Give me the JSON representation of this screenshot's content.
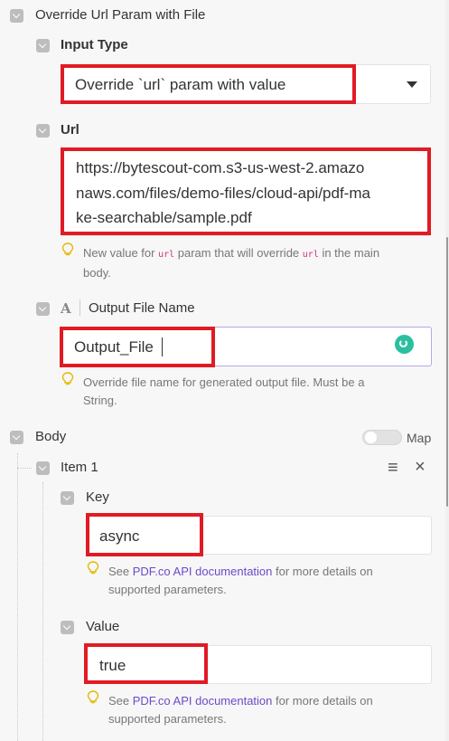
{
  "override_section": {
    "title": "Override Url Param with File"
  },
  "input_type": {
    "label": "Input Type",
    "value": "Override `url` param with value"
  },
  "url": {
    "label": "Url",
    "lines": [
      "https://bytescout-com.s3-us-west-2.amazo",
      "naws.com/files/demo-files/cloud-api/pdf-ma",
      "ke-searchable/sample.pdf"
    ],
    "help_prefix": "New value for ",
    "help_code1": "url",
    "help_mid": " param that will override ",
    "help_code2": "url",
    "help_suffix": " in the main",
    "help_line2": "body."
  },
  "output_file": {
    "type_glyph": "A",
    "label": "Output File Name",
    "value": "Output_File",
    "help_line1": "Override file name for generated output file. Must be a",
    "help_line2": "String."
  },
  "body": {
    "label": "Body",
    "map_label": "Map",
    "item": {
      "label": "Item 1",
      "menu_icon": "≡",
      "close_icon": "×",
      "key": {
        "label": "Key",
        "value": "async",
        "help_pre": "See ",
        "help_link": "PDF.co API documentation",
        "help_post": " for more details on",
        "help_line2": "supported parameters."
      },
      "value_field": {
        "label": "Value",
        "value": "true",
        "help_pre": "See ",
        "help_link": "PDF.co API documentation",
        "help_post": " for more details on",
        "help_line2": "supported parameters."
      }
    }
  },
  "colors": {
    "highlight": "#e01b24",
    "link": "#6a4bc8",
    "code": "#d0357a",
    "accent": "#2bbfa0"
  }
}
